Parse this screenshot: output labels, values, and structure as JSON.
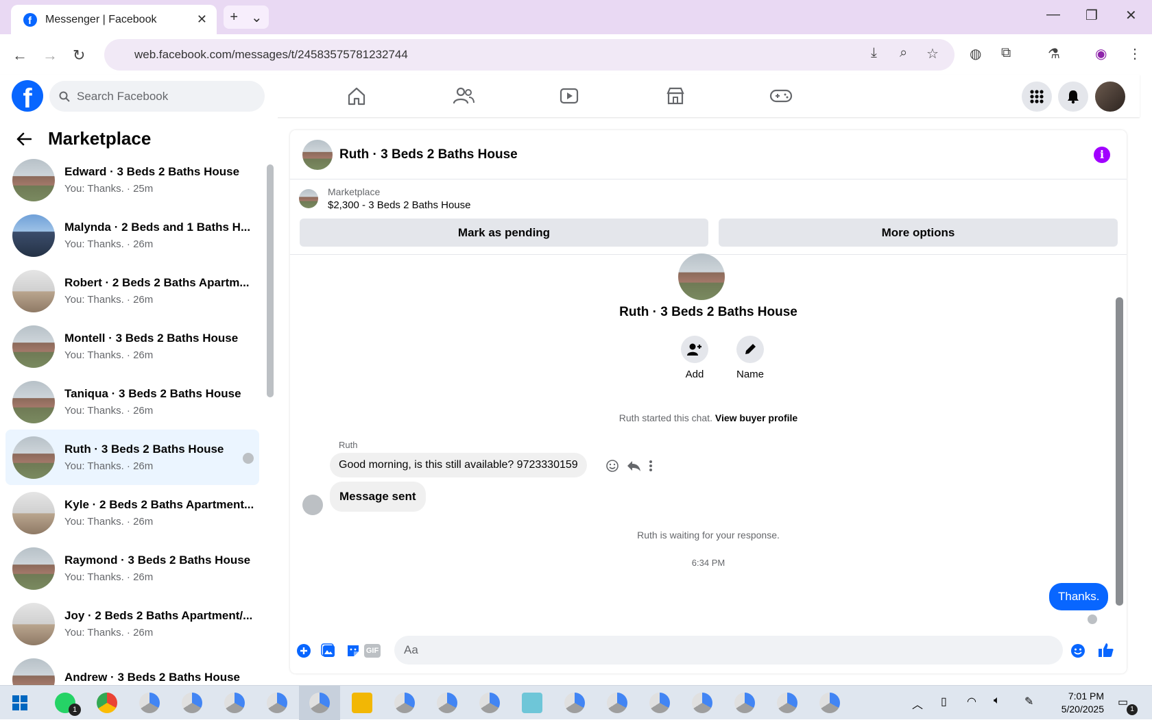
{
  "browser": {
    "tab_title": "Messenger | Facebook",
    "tab_close": "✕",
    "new_tab": "+",
    "tab_menu": "⌄",
    "url": "web.facebook.com/messages/t/24583575781232744"
  },
  "window": {
    "minimize": "—",
    "restore": "❐",
    "close": "✕"
  },
  "facebook": {
    "logo": "f",
    "search_placeholder": "Search Facebook"
  },
  "sidebar": {
    "title": "Marketplace",
    "conversations": [
      {
        "name": "Edward · 3 Beds 2 Baths House",
        "preview": "You: Thanks. · 25m"
      },
      {
        "name": "Malynda · 2 Beds and 1 Baths H...",
        "preview": "You: Thanks. · 26m"
      },
      {
        "name": "Robert · 2 Beds 2 Baths Apartm...",
        "preview": "You: Thanks. · 26m"
      },
      {
        "name": "Montell · 3 Beds 2 Baths House",
        "preview": "You: Thanks. · 26m"
      },
      {
        "name": "Taniqua · 3 Beds 2 Baths House",
        "preview": "You: Thanks. · 26m"
      },
      {
        "name": "Ruth · 3 Beds 2 Baths House",
        "preview": "You: Thanks. · 26m"
      },
      {
        "name": "Kyle · 2 Beds 2 Baths Apartment...",
        "preview": "You: Thanks. · 26m"
      },
      {
        "name": "Raymond · 3 Beds 2 Baths House",
        "preview": "You: Thanks. · 26m"
      },
      {
        "name": "Joy · 2 Beds 2 Baths Apartment/...",
        "preview": "You: Thanks. · 26m"
      },
      {
        "name": "Andrew · 3 Beds 2 Baths House",
        "preview": ""
      }
    ]
  },
  "chat": {
    "title": "Ruth · 3 Beds 2 Baths House",
    "listing_source": "Marketplace",
    "listing": "$2,300 - 3 Beds 2 Baths House",
    "mark_pending": "Mark as pending",
    "more_options": "More options",
    "profile_name": "Ruth · 3 Beds 2 Baths House",
    "add_label": "Add",
    "name_label": "Name",
    "started": "Ruth started this chat.",
    "view_profile": "View buyer profile",
    "sender": "Ruth",
    "message1": "Good morning, is this still available? 9723330159",
    "message2": "Message sent",
    "waiting": "Ruth is waiting for your response.",
    "time": "6:34 PM",
    "my_message": "Thanks.",
    "composer_placeholder": "Aa",
    "gif": "GIF"
  },
  "taskbar": {
    "time": "7:01 PM",
    "date": "5/20/2025",
    "whatsapp_badge": "1",
    "notification_badge": "1"
  }
}
